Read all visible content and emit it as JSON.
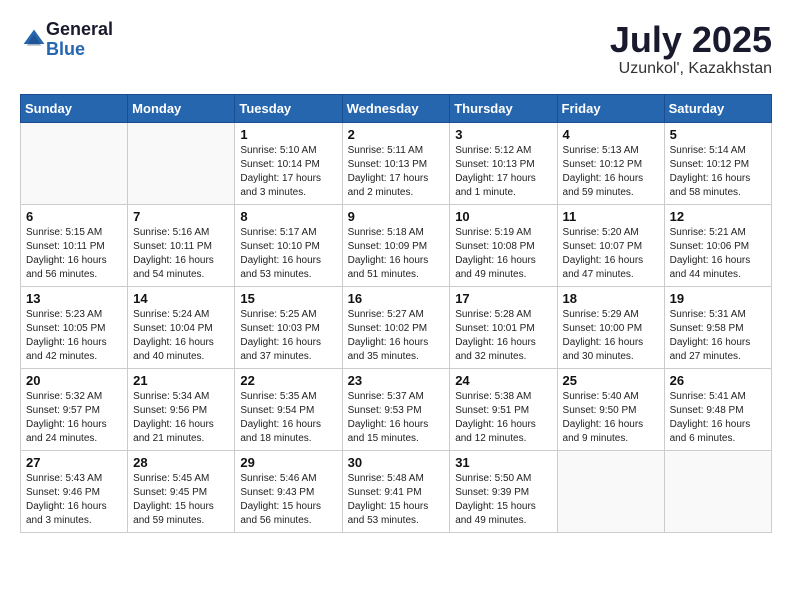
{
  "logo": {
    "general": "General",
    "blue": "Blue"
  },
  "title": {
    "month": "July 2025",
    "location": "Uzunkol', Kazakhstan"
  },
  "weekdays": [
    "Sunday",
    "Monday",
    "Tuesday",
    "Wednesday",
    "Thursday",
    "Friday",
    "Saturday"
  ],
  "weeks": [
    [
      {
        "day": "",
        "info": ""
      },
      {
        "day": "",
        "info": ""
      },
      {
        "day": "1",
        "info": "Sunrise: 5:10 AM\nSunset: 10:14 PM\nDaylight: 17 hours\nand 3 minutes."
      },
      {
        "day": "2",
        "info": "Sunrise: 5:11 AM\nSunset: 10:13 PM\nDaylight: 17 hours\nand 2 minutes."
      },
      {
        "day": "3",
        "info": "Sunrise: 5:12 AM\nSunset: 10:13 PM\nDaylight: 17 hours\nand 1 minute."
      },
      {
        "day": "4",
        "info": "Sunrise: 5:13 AM\nSunset: 10:12 PM\nDaylight: 16 hours\nand 59 minutes."
      },
      {
        "day": "5",
        "info": "Sunrise: 5:14 AM\nSunset: 10:12 PM\nDaylight: 16 hours\nand 58 minutes."
      }
    ],
    [
      {
        "day": "6",
        "info": "Sunrise: 5:15 AM\nSunset: 10:11 PM\nDaylight: 16 hours\nand 56 minutes."
      },
      {
        "day": "7",
        "info": "Sunrise: 5:16 AM\nSunset: 10:11 PM\nDaylight: 16 hours\nand 54 minutes."
      },
      {
        "day": "8",
        "info": "Sunrise: 5:17 AM\nSunset: 10:10 PM\nDaylight: 16 hours\nand 53 minutes."
      },
      {
        "day": "9",
        "info": "Sunrise: 5:18 AM\nSunset: 10:09 PM\nDaylight: 16 hours\nand 51 minutes."
      },
      {
        "day": "10",
        "info": "Sunrise: 5:19 AM\nSunset: 10:08 PM\nDaylight: 16 hours\nand 49 minutes."
      },
      {
        "day": "11",
        "info": "Sunrise: 5:20 AM\nSunset: 10:07 PM\nDaylight: 16 hours\nand 47 minutes."
      },
      {
        "day": "12",
        "info": "Sunrise: 5:21 AM\nSunset: 10:06 PM\nDaylight: 16 hours\nand 44 minutes."
      }
    ],
    [
      {
        "day": "13",
        "info": "Sunrise: 5:23 AM\nSunset: 10:05 PM\nDaylight: 16 hours\nand 42 minutes."
      },
      {
        "day": "14",
        "info": "Sunrise: 5:24 AM\nSunset: 10:04 PM\nDaylight: 16 hours\nand 40 minutes."
      },
      {
        "day": "15",
        "info": "Sunrise: 5:25 AM\nSunset: 10:03 PM\nDaylight: 16 hours\nand 37 minutes."
      },
      {
        "day": "16",
        "info": "Sunrise: 5:27 AM\nSunset: 10:02 PM\nDaylight: 16 hours\nand 35 minutes."
      },
      {
        "day": "17",
        "info": "Sunrise: 5:28 AM\nSunset: 10:01 PM\nDaylight: 16 hours\nand 32 minutes."
      },
      {
        "day": "18",
        "info": "Sunrise: 5:29 AM\nSunset: 10:00 PM\nDaylight: 16 hours\nand 30 minutes."
      },
      {
        "day": "19",
        "info": "Sunrise: 5:31 AM\nSunset: 9:58 PM\nDaylight: 16 hours\nand 27 minutes."
      }
    ],
    [
      {
        "day": "20",
        "info": "Sunrise: 5:32 AM\nSunset: 9:57 PM\nDaylight: 16 hours\nand 24 minutes."
      },
      {
        "day": "21",
        "info": "Sunrise: 5:34 AM\nSunset: 9:56 PM\nDaylight: 16 hours\nand 21 minutes."
      },
      {
        "day": "22",
        "info": "Sunrise: 5:35 AM\nSunset: 9:54 PM\nDaylight: 16 hours\nand 18 minutes."
      },
      {
        "day": "23",
        "info": "Sunrise: 5:37 AM\nSunset: 9:53 PM\nDaylight: 16 hours\nand 15 minutes."
      },
      {
        "day": "24",
        "info": "Sunrise: 5:38 AM\nSunset: 9:51 PM\nDaylight: 16 hours\nand 12 minutes."
      },
      {
        "day": "25",
        "info": "Sunrise: 5:40 AM\nSunset: 9:50 PM\nDaylight: 16 hours\nand 9 minutes."
      },
      {
        "day": "26",
        "info": "Sunrise: 5:41 AM\nSunset: 9:48 PM\nDaylight: 16 hours\nand 6 minutes."
      }
    ],
    [
      {
        "day": "27",
        "info": "Sunrise: 5:43 AM\nSunset: 9:46 PM\nDaylight: 16 hours\nand 3 minutes."
      },
      {
        "day": "28",
        "info": "Sunrise: 5:45 AM\nSunset: 9:45 PM\nDaylight: 15 hours\nand 59 minutes."
      },
      {
        "day": "29",
        "info": "Sunrise: 5:46 AM\nSunset: 9:43 PM\nDaylight: 15 hours\nand 56 minutes."
      },
      {
        "day": "30",
        "info": "Sunrise: 5:48 AM\nSunset: 9:41 PM\nDaylight: 15 hours\nand 53 minutes."
      },
      {
        "day": "31",
        "info": "Sunrise: 5:50 AM\nSunset: 9:39 PM\nDaylight: 15 hours\nand 49 minutes."
      },
      {
        "day": "",
        "info": ""
      },
      {
        "day": "",
        "info": ""
      }
    ]
  ]
}
